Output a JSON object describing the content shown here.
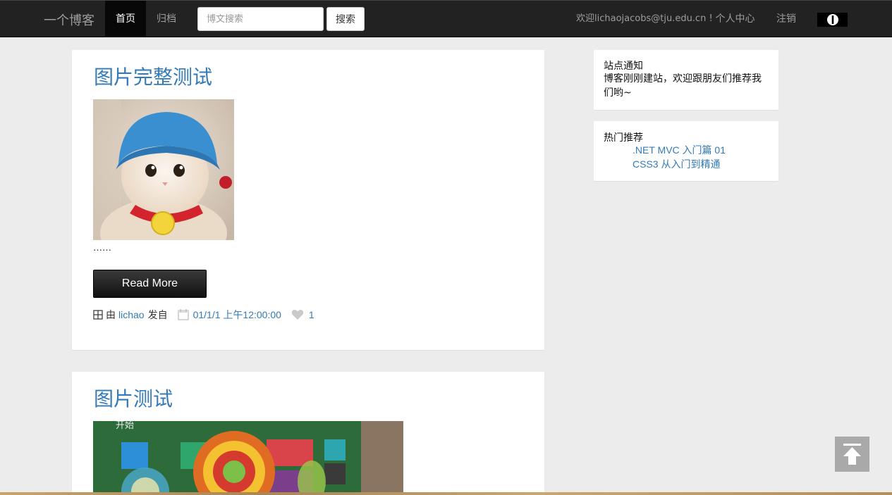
{
  "navbar": {
    "brand": "一个博客",
    "home_label": "首页",
    "archive_label": "归档",
    "search_placeholder": "博文搜索",
    "search_button": "搜索",
    "welcome": "欢迎lichaojacobs@tju.edu.cn !",
    "profile_label": "个人中心",
    "logout_label": "注销",
    "power_icon": "power-icon"
  },
  "posts": [
    {
      "title": "图片完整测试",
      "image": "cat-with-blue-knit-hat",
      "excerpt": "……",
      "read_more": "Read More",
      "meta": {
        "by": "由",
        "author": "lichao",
        "posted": "发自",
        "date": "01/1/1 上午12:00:00",
        "likes": "1"
      }
    },
    {
      "title": "图片测试",
      "image": "windows8-start-screen-with-lollipops",
      "screen_text": "开始"
    }
  ],
  "sidebar": {
    "notice": {
      "title": "站点通知",
      "text": "博客刚刚建站，欢迎跟朋友们推荐我们哟~"
    },
    "hot": {
      "title": "热门推荐",
      "items": [
        ".NET MVC 入门篇 01",
        "CSS3 从入门到精通"
      ]
    }
  },
  "colors": {
    "navbar": "#222222",
    "link": "#337ab7",
    "page_bg": "#ececec"
  }
}
